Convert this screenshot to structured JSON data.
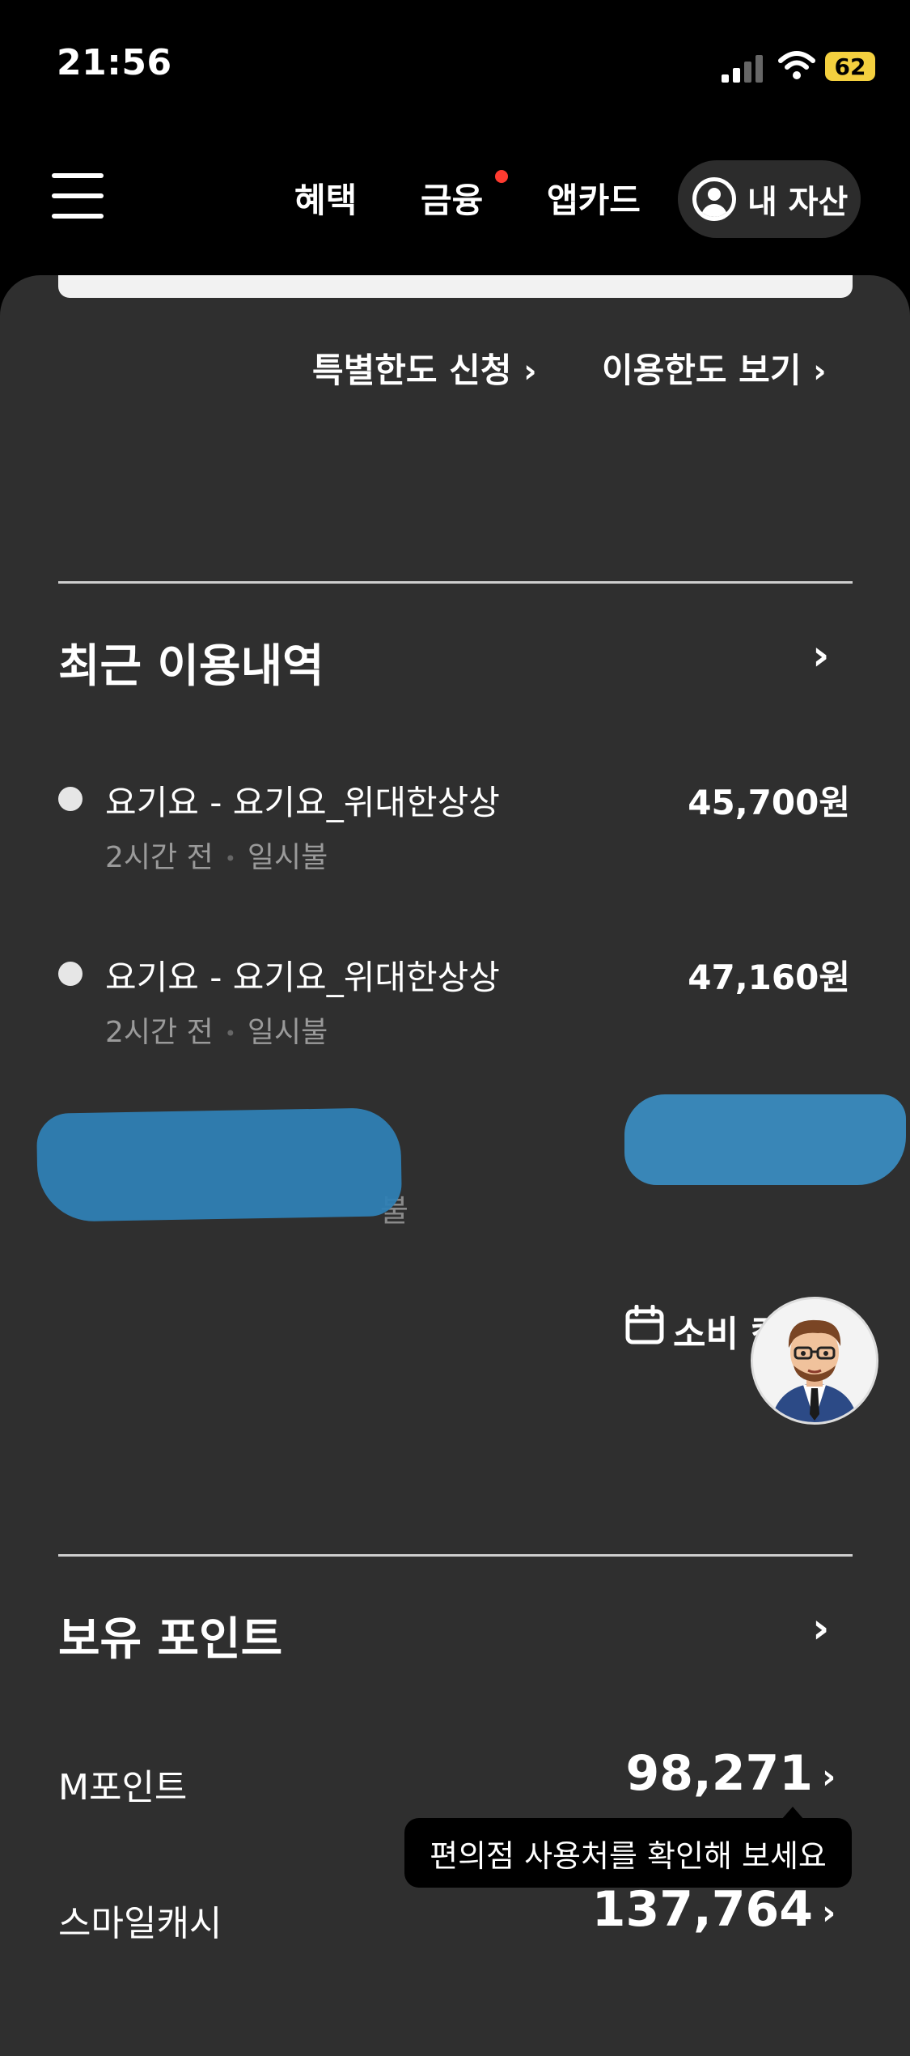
{
  "status_bar": {
    "time": "21:56",
    "battery": "62"
  },
  "nav": {
    "benefits": "혜택",
    "finance": "금융",
    "appcard": "앱카드",
    "my_assets": "내 자산"
  },
  "limits": {
    "special_limit": "특별한도 신청",
    "view_limit": "이용한도 보기"
  },
  "recent": {
    "title": "최근 이용내역",
    "items": [
      {
        "merchant": "요기요 - 요기요_위대한상상",
        "amount": "45,700원",
        "time": "2시간 전",
        "type": "일시불"
      },
      {
        "merchant": "요기요 - 요기요_위대한상상",
        "amount": "47,160원",
        "time": "2시간 전",
        "type": "일시불"
      }
    ],
    "ghost_text": "불"
  },
  "calendar": {
    "label": "소비 캘"
  },
  "points": {
    "title": "보유 포인트",
    "m_point_label": "M포인트",
    "m_point_value": "98,271",
    "tooltip": "편의점 사용처를 확인해 보세요",
    "smile_label": "스마일캐시",
    "smile_value": "137,764"
  }
}
